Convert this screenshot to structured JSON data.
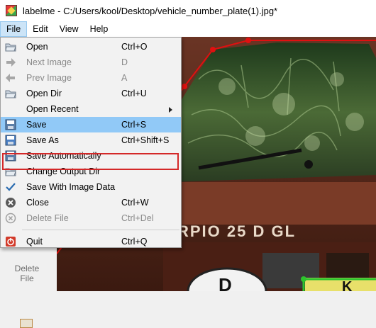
{
  "window": {
    "title": "labelme - C:/Users/kool/Desktop/vehicle_number_plate(1).jpg*"
  },
  "menubar": [
    {
      "label": "File",
      "active": true
    },
    {
      "label": "Edit"
    },
    {
      "label": "View"
    },
    {
      "label": "Help"
    }
  ],
  "file_menu": {
    "items": [
      {
        "label": "Open",
        "shortcut": "Ctrl+O",
        "icon": "open-folder-icon"
      },
      {
        "label": "Next Image",
        "shortcut": "D",
        "icon": "next-arrow-icon",
        "disabled": true
      },
      {
        "label": "Prev Image",
        "shortcut": "A",
        "icon": "prev-arrow-icon",
        "disabled": true
      },
      {
        "label": "Open Dir",
        "shortcut": "Ctrl+U",
        "icon": "open-folder-icon"
      },
      {
        "label": "Open Recent",
        "shortcut": "",
        "icon": "",
        "submenu": true
      },
      {
        "label": "Save",
        "shortcut": "Ctrl+S",
        "icon": "save-icon",
        "highlighted": true
      },
      {
        "label": "Save As",
        "shortcut": "Ctrl+Shift+S",
        "icon": "save-as-icon"
      },
      {
        "label": "Save Automatically",
        "shortcut": "",
        "icon": "save-icon"
      },
      {
        "label": "Change Output Dir",
        "shortcut": "",
        "icon": "open-folder-icon"
      },
      {
        "label": "Save With Image Data",
        "shortcut": "",
        "icon": "checkmark-icon"
      },
      {
        "label": "Close",
        "shortcut": "Ctrl+W",
        "icon": "close-circle-icon"
      },
      {
        "label": "Delete File",
        "shortcut": "Ctrl+Del",
        "icon": "delete-circle-icon",
        "disabled": true
      },
      {
        "label": "Quit",
        "shortcut": "Ctrl+Q",
        "icon": "quit-icon"
      }
    ]
  },
  "toolbar": {
    "delete_file_label": "Delete\nFile"
  },
  "canvas": {
    "plate_text": "RPIO 25 D GL",
    "badge_letter": "D",
    "badge2_text": "K"
  },
  "colors": {
    "menu_highlight": "#91c9f7",
    "annotation_red": "#d42828",
    "polygon_red": "#e01010",
    "polygon_green": "#2cc42c"
  }
}
